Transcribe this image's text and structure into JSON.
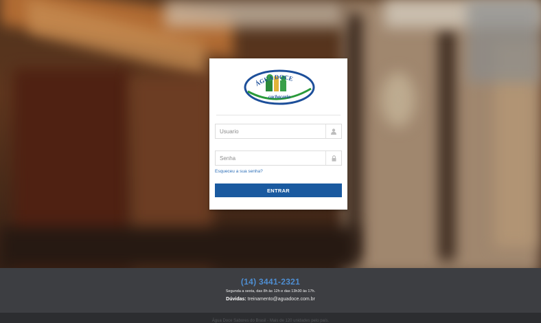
{
  "login": {
    "logo_text": "ÁGUA DOCE",
    "logo_subtext": "cachaçaria",
    "username_placeholder": "Usuario",
    "password_placeholder": "Senha",
    "forgot_link": "Esqueceu a sua senha?",
    "submit_label": "ENTRAR"
  },
  "footer": {
    "phone": "(14) 3441-2321",
    "hours": "Segunda a sexta, das 8h às 12h e das 13h30 às 17h.",
    "contact_label": "Dúvidas:",
    "contact_email": "treinamento@aguadoce.com.br",
    "copyright": "Água Doce Sabores do Brasil - Mais de 120 unidades pelo país."
  },
  "icons": {
    "username": "user-icon",
    "password": "lock-icon"
  },
  "colors": {
    "button": "#1a5aa0",
    "phone": "#4e8ed2",
    "footer": "#3d3e42",
    "footer_bottom": "#2c2d30"
  }
}
